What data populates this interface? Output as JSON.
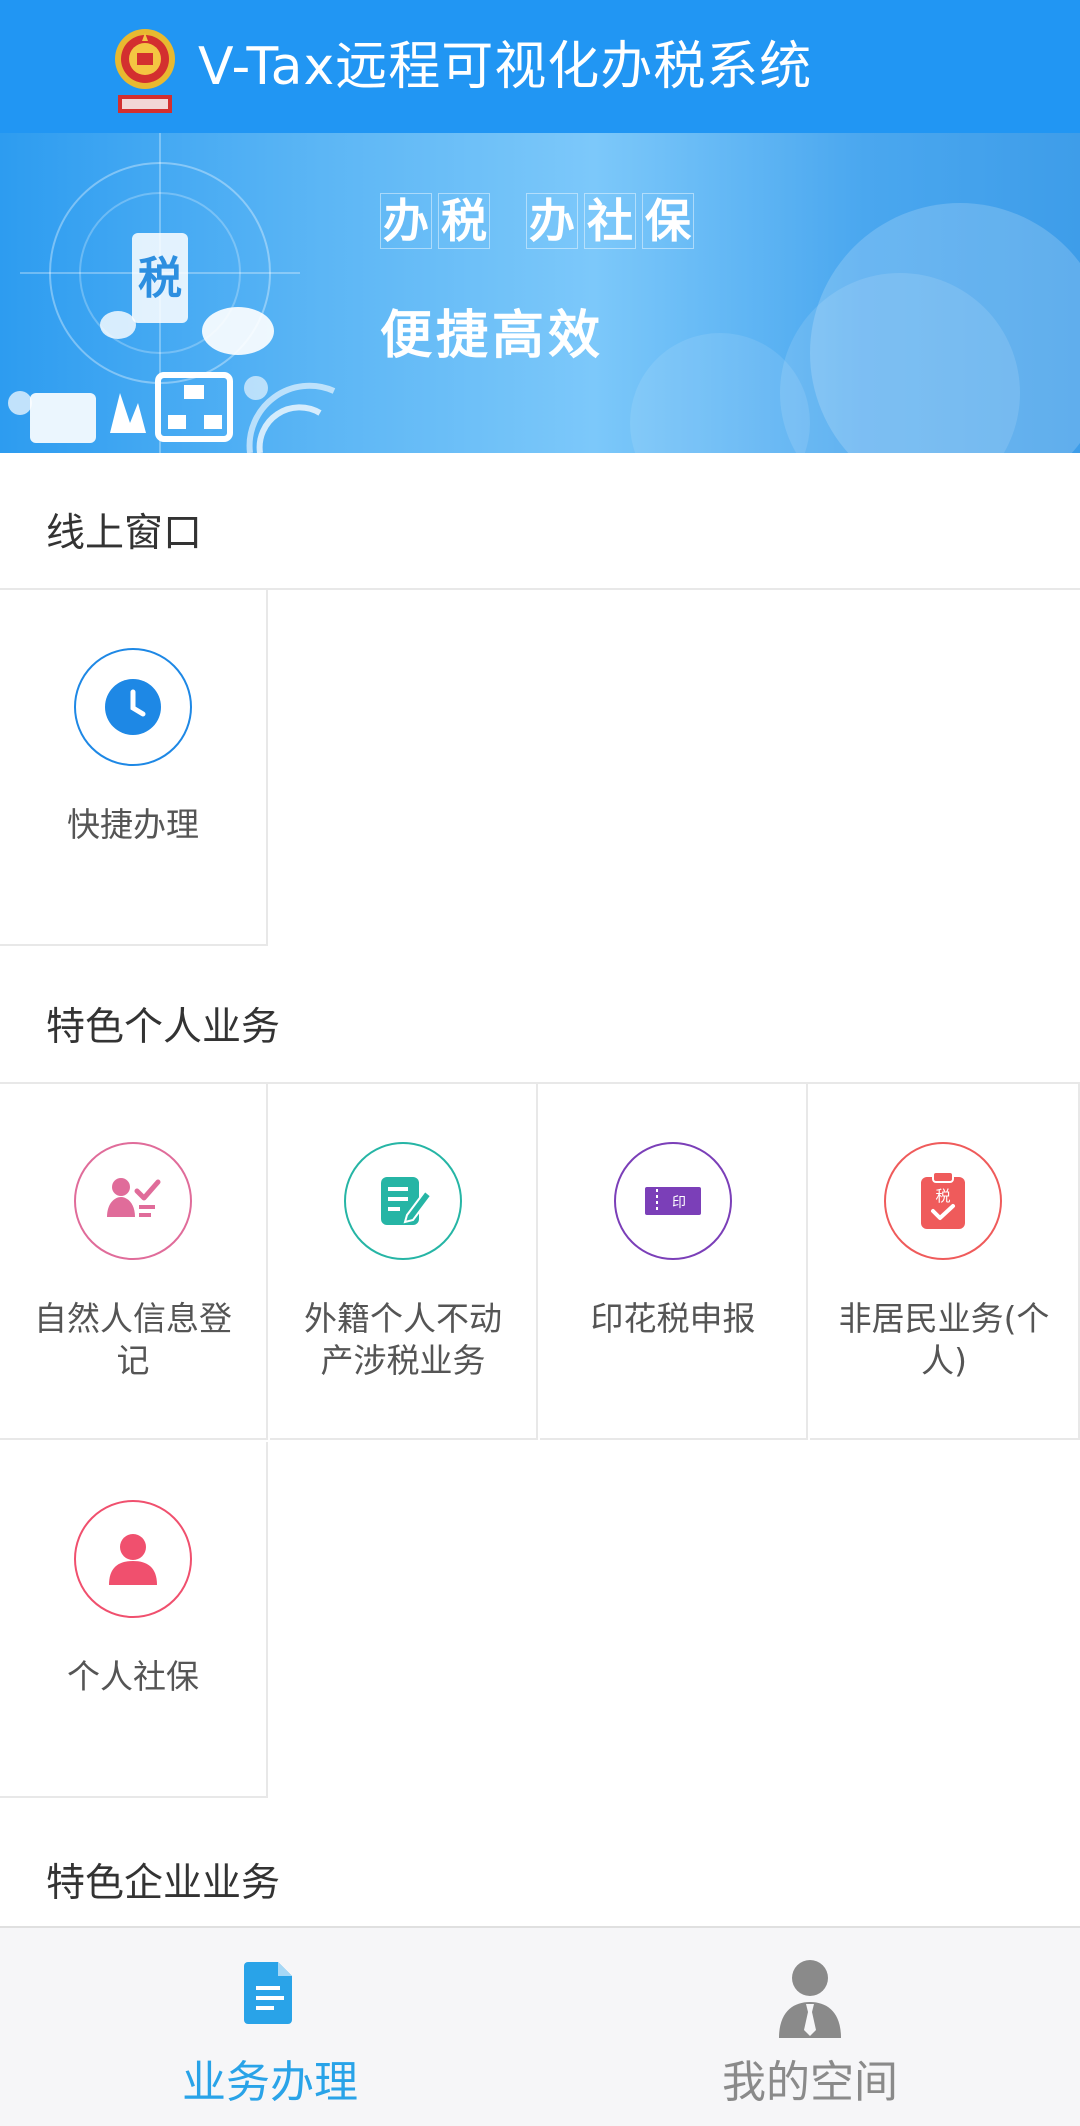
{
  "header": {
    "title": "V-Tax远程可视化办税系统",
    "emblem_icon": "tax-emblem-icon",
    "background": "#2196f3"
  },
  "banner": {
    "line1": [
      "办",
      "税",
      "办",
      "社",
      "保"
    ],
    "line2": "便捷高效"
  },
  "sections": [
    {
      "title": "线上窗口",
      "items": [
        {
          "label": "快捷办理",
          "icon": "clock-icon",
          "color": "#1e88e5"
        }
      ]
    },
    {
      "title": "特色个人业务",
      "items": [
        {
          "label": "自然人信息登记",
          "icon": "person-check-icon",
          "color": "#e06c9a"
        },
        {
          "label": "外籍个人不动产涉税业务",
          "icon": "edit-document-icon",
          "color": "#26b5a5"
        },
        {
          "label": "印花税申报",
          "icon": "stamp-ticket-icon",
          "color": "#7b3fb8"
        },
        {
          "label": "非居民业务(个人)",
          "icon": "tax-clipboard-icon",
          "color": "#ef5b5b"
        },
        {
          "label": "个人社保",
          "icon": "person-icon",
          "color": "#f0506e"
        }
      ]
    },
    {
      "title": "特色企业业务",
      "items": []
    }
  ],
  "tabbar": {
    "tabs": [
      {
        "label": "业务办理",
        "icon": "document-icon",
        "active": true,
        "color": "#29a3e8"
      },
      {
        "label": "我的空间",
        "icon": "user-icon",
        "active": false,
        "color": "#8a8a8a"
      }
    ]
  }
}
